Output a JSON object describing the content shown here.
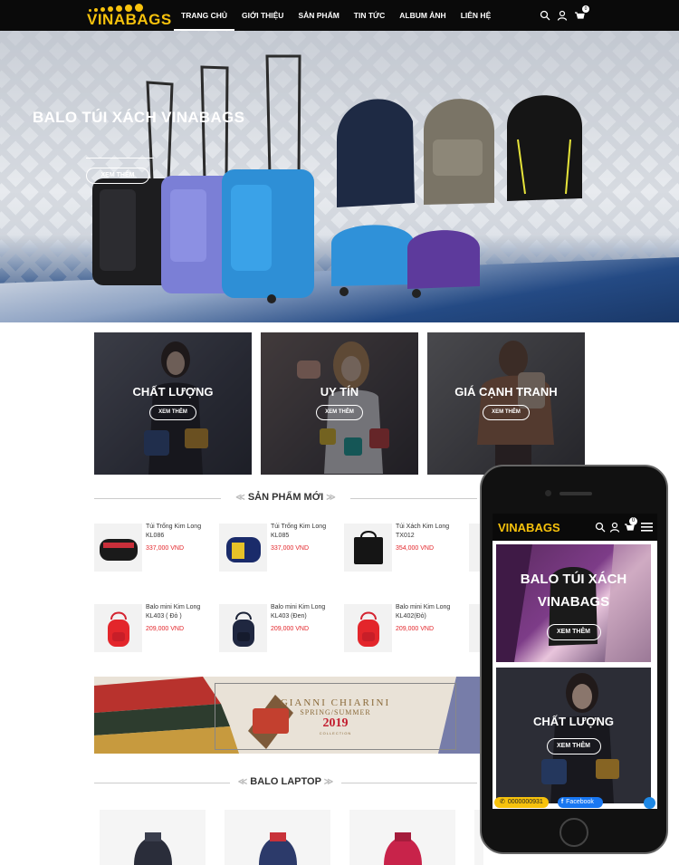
{
  "header": {
    "logo_text": "VINABAGS",
    "nav": [
      "TRANG CHỦ",
      "GIỚI THIỆU",
      "SẢN PHẨM",
      "TIN TỨC",
      "ALBUM ẢNH",
      "LIÊN HỆ"
    ],
    "active_index": 0,
    "cart_count": "0"
  },
  "hero": {
    "title": "BALO TÚI XÁCH VINABAGS",
    "button": "XEM THÊM"
  },
  "features": [
    {
      "title": "CHẤT LƯỢNG",
      "button": "XEM THÊM"
    },
    {
      "title": "UY TÍN",
      "button": "XEM THÊM"
    },
    {
      "title": "GIÁ CẠNH TRANH",
      "button": "XEM THÊM"
    }
  ],
  "sections": {
    "new_products": "SẢN PHẨM MỚI",
    "laptop": "BALO LAPTOP"
  },
  "products": [
    {
      "name": "Túi Trống Kim Long KL086",
      "price": "337,000 VND"
    },
    {
      "name": "Túi Trống Kim Long KL085",
      "price": "337,000 VND"
    },
    {
      "name": "Túi Xách Kim Long TX012",
      "price": "354,000 VND"
    },
    {
      "name": "Balo mini Kim Long KL403 ( Đỏ )",
      "price": "209,000 VND"
    },
    {
      "name": "Balo mini Kim Long KL403 (Đen)",
      "price": "209,000 VND"
    },
    {
      "name": "Balo mini Kim Long KL402(Đỏ)",
      "price": "209,000 VND"
    }
  ],
  "banner": {
    "brand": "GIANNI CHIARINI",
    "season": "SPRING/SUMMER",
    "year": "2019",
    "collection": "COLLECTION"
  },
  "mobile": {
    "logo_text": "VINABAGS",
    "cart_count": "0",
    "hero_title_line1": "BALO TÚI XÁCH",
    "hero_title_line2": "VINABAGS",
    "hero_button": "XEM THÊM",
    "feature_title": "CHẤT LƯỢNG",
    "feature_button": "XEM THÊM",
    "phone_number": "0000000931",
    "facebook": "Facebook"
  },
  "colors": {
    "brand_yellow": "#f7c20c",
    "header_bg": "#0a0a0a",
    "price_red": "#e3262b"
  }
}
